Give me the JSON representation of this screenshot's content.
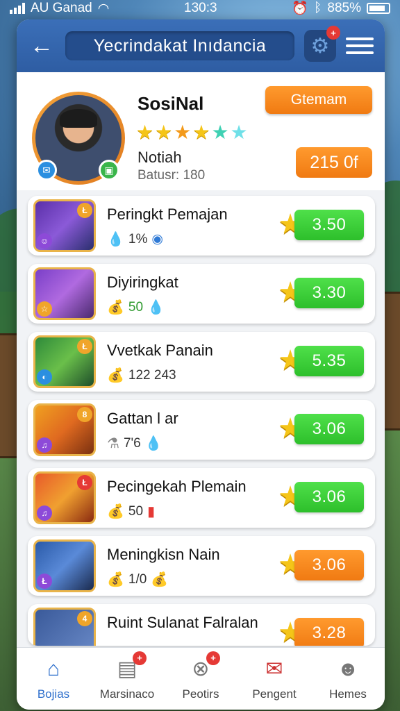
{
  "status_bar": {
    "carrier": "AU Ganad",
    "time": "130:3",
    "battery": "885%"
  },
  "header": {
    "title": "Yecrindakat Inıdancia",
    "settings_badge": "+"
  },
  "profile": {
    "name": "SosiNal",
    "subtitle": "Notiah",
    "status": "Batusr: 180",
    "action_label": "Gtemam",
    "coins": "215 0f",
    "star_count": 6
  },
  "items": [
    {
      "title": "Peringkt Pemajan",
      "meta": "1%",
      "score": "3.50",
      "score_color": "green"
    },
    {
      "title": "Diyiringkat",
      "meta": "50",
      "score": "3.30",
      "score_color": "green"
    },
    {
      "title": "Vvetkak Panain",
      "meta": "122 243",
      "score": "5.35",
      "score_color": "green"
    },
    {
      "title": "Gattan l ar",
      "meta": "7'6",
      "score": "3.06",
      "score_color": "green"
    },
    {
      "title": "Pecingekah Plemain",
      "meta": "50",
      "score": "3.06",
      "score_color": "green"
    },
    {
      "title": "Meningkisn Nain",
      "meta": "1/0",
      "score": "3.06",
      "score_color": "orange"
    },
    {
      "title": "Ruint Sulanat Falralan",
      "meta": "",
      "score": "3.28",
      "score_color": "orange"
    }
  ],
  "nav": [
    {
      "label": "Bojias",
      "icon": "home-icon",
      "active": true
    },
    {
      "label": "Marsinaco",
      "icon": "inbox-icon",
      "badge": "+"
    },
    {
      "label": "Peotirs",
      "icon": "close-circle-icon",
      "badge": "+"
    },
    {
      "label": "Pengent",
      "icon": "mail-icon"
    },
    {
      "label": "Hemes",
      "icon": "people-icon"
    }
  ]
}
